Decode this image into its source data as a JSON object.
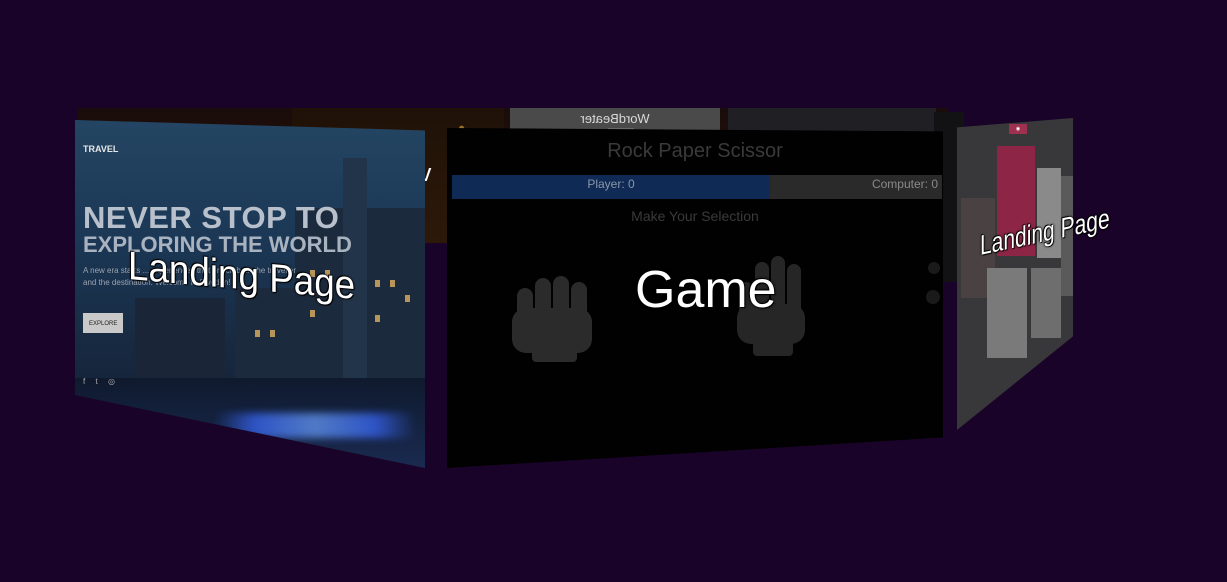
{
  "back_row": {
    "wordbeater_label": "WordBeater",
    "pages_label": "ve"
  },
  "travel_card": {
    "brand": "TRAVEL",
    "headline_1": "NEVER STOP TO",
    "headline_2": "EXPLORING THE WORLD",
    "paragraph": "A new era starts ... experiences that enrich both the traveller and the destination. Welcome to Sweden!",
    "button": "EXPLORE",
    "social": [
      "f",
      "t",
      "◎"
    ]
  },
  "game_card": {
    "title": "Rock Paper Scissor",
    "player_score": "Player: 0",
    "computer_score": "Computer: 0",
    "prompt": "Make Your Selection"
  },
  "landing_right": {
    "badge": "◉"
  },
  "overlay_labels": {
    "left": "Landing Page",
    "center": "Game",
    "right": "Landing Page"
  },
  "colors": {
    "background": "#1a0328",
    "player_bar": "#0e2a55",
    "label_text": "#ffffff"
  }
}
